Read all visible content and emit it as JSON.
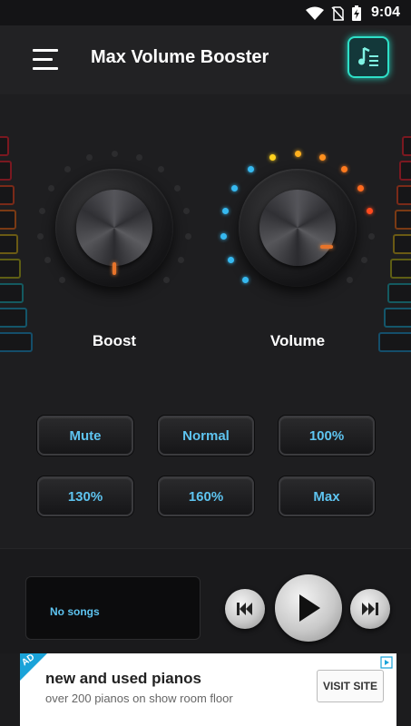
{
  "status_bar": {
    "time": "9:04",
    "icons": [
      "wifi-icon",
      "no-sim-icon",
      "battery-charging-icon"
    ]
  },
  "app_bar": {
    "title": "Max Volume Booster",
    "menu_icon": "hamburger-menu-icon",
    "music_icon": "music-playlist-icon"
  },
  "knobs": {
    "boost_label": "Boost",
    "volume_label": "Volume",
    "boost_level": 0,
    "volume_level": 0.8
  },
  "presets": [
    {
      "label": "Mute"
    },
    {
      "label": "Normal"
    },
    {
      "label": "100%"
    },
    {
      "label": "130%"
    },
    {
      "label": "160%"
    },
    {
      "label": "Max"
    }
  ],
  "player": {
    "song_text": "No songs",
    "prev_icon": "previous-track-icon",
    "play_icon": "play-icon",
    "next_icon": "next-track-icon"
  },
  "ad": {
    "badge": "AD",
    "headline": "new and used pianos",
    "subtext": "over 200 pianos on show room floor",
    "cta": "VISIT SITE"
  },
  "colors": {
    "accent": "#5ec4f0",
    "teal": "#2ee0c8",
    "indicator": "#e8742a"
  }
}
